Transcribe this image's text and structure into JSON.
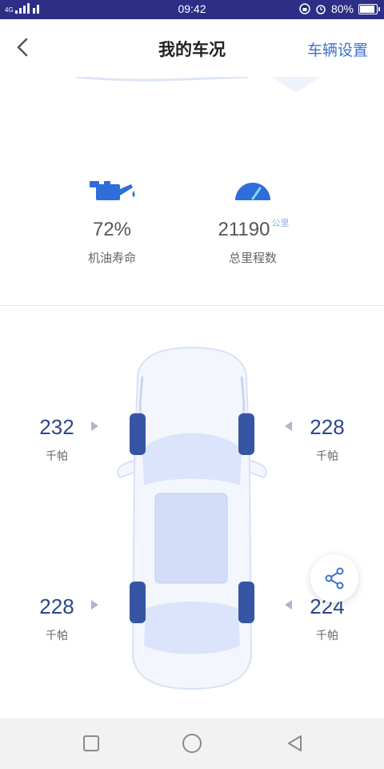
{
  "status_bar": {
    "time": "09:42",
    "network": "4G",
    "battery_percent": "80%",
    "battery_level": 0.8
  },
  "header": {
    "title": "我的车况",
    "settings_label": "车辆设置"
  },
  "stats": {
    "oil": {
      "value": "72%",
      "label": "机油寿命"
    },
    "mileage": {
      "value": "21190",
      "unit": "公里",
      "label": "总里程数"
    }
  },
  "tires": {
    "front_left": {
      "value": "232",
      "unit": "千帕"
    },
    "front_right": {
      "value": "228",
      "unit": "千帕"
    },
    "rear_left": {
      "value": "228",
      "unit": "千帕"
    },
    "rear_right": {
      "value": "224",
      "unit": "千帕"
    }
  },
  "colors": {
    "status_bar": "#2d2f86",
    "accent": "#3d72c9",
    "tire_value": "#2b478c"
  }
}
